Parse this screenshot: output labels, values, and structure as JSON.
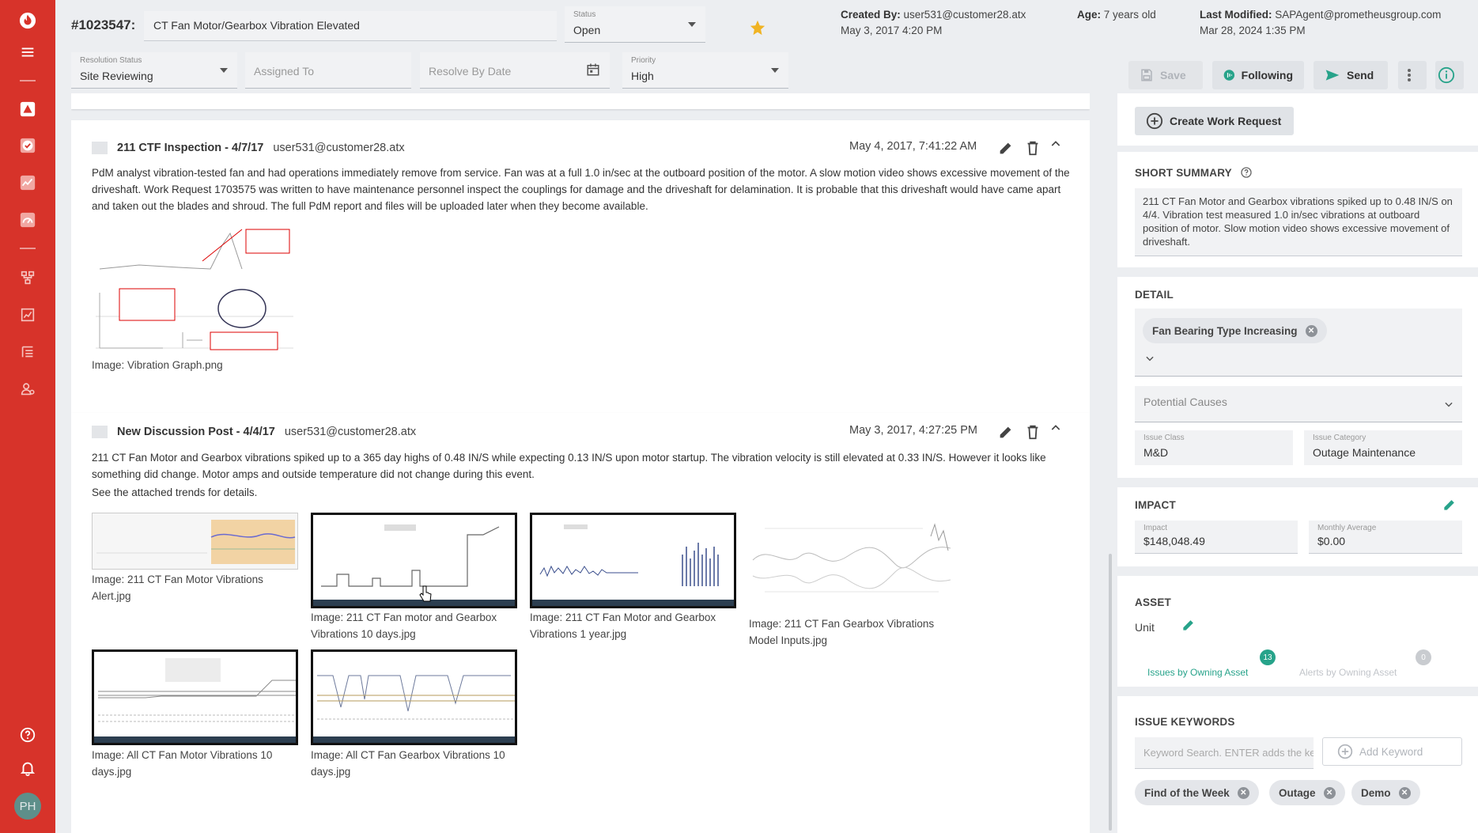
{
  "header": {
    "issue_id": "#1023547:",
    "title": "CT Fan Motor/Gearbox Vibration Elevated",
    "status_label": "Status",
    "status_value": "Open",
    "resolution_label": "Resolution Status",
    "resolution_value": "Site Reviewing",
    "assigned_placeholder": "Assigned To",
    "resolve_placeholder": "Resolve By Date",
    "priority_label": "Priority",
    "priority_value": "High",
    "created_label": "Created By:",
    "created_by": "user531@customer28.atx",
    "created_date": "May 3, 2017 4:20 PM",
    "age_label": "Age:",
    "age_value": "7 years old",
    "modified_label": "Last Modified:",
    "modified_by": "SAPAgent@prometheusgroup.com",
    "modified_date": "Mar 28, 2024 1:35 PM",
    "save_label": "Save",
    "following_label": "Following",
    "send_label": "Send"
  },
  "posts": [
    {
      "title": "211 CTF Inspection - 4/7/17",
      "author": "user531@customer28.atx",
      "date": "May 4, 2017, 7:41:22 AM",
      "body": "PdM analyst vibration-tested fan and had operations immediately remove from service. Fan was at a full 1.0 in/sec at the outboard position of the motor. A slow motion video shows excessive movement of the driveshaft. Work Request 1703575 was written to have maintenance personnel inspect the couplings for damage and the driveshaft for delamination. It is probable that this driveshaft would have came apart and taken out the blades and shroud. The full PdM report and files will be uploaded later when they become available.",
      "images": [
        {
          "caption": "Image: Vibration Graph.png"
        }
      ]
    },
    {
      "title": "New Discussion Post - 4/4/17",
      "author": "user531@customer28.atx",
      "date": "May 3, 2017, 4:27:25 PM",
      "body": "211 CT Fan Motor and Gearbox vibrations spiked up to a 365 day highs of 0.48 IN/S while expecting 0.13 IN/S upon motor startup.  The vibration velocity is still elevated at 0.33 IN/S. However it looks like something did change.  Motor amps and outside temperature did not change during this event.",
      "body2": "See the attached trends for details.",
      "images": [
        {
          "caption": "Image: 211 CT Fan Motor Vibrations Alert.jpg"
        },
        {
          "caption": "Image: 211 CT Fan motor and Gearbox Vibrations 10 days.jpg"
        },
        {
          "caption": "Image: 211 CT Fan Motor and Gearbox Vibrations 1 year.jpg"
        },
        {
          "caption": "Image: 211 CT Fan Gearbox Vibrations Model Inputs.jpg"
        },
        {
          "caption": "Image: All CT Fan Motor Vibrations 10 days.jpg"
        },
        {
          "caption": "Image: All CT Fan Gearbox Vibrations 10 days.jpg"
        }
      ]
    }
  ],
  "panel": {
    "create_work_request": "Create Work Request",
    "short_summary_title": "SHORT SUMMARY",
    "short_summary": "211 CT Fan Motor and Gearbox vibrations spiked up to 0.48 IN/S on 4/4. Vibration test measured 1.0 in/sec vibrations at outboard position of motor. Slow motion video shows excessive movement of driveshaft.",
    "detail_title": "DETAIL",
    "detail_chip": "Fan Bearing Type Increasing",
    "potential_causes": "Potential Causes",
    "issue_class_label": "Issue Class",
    "issue_class_value": "M&D",
    "issue_category_label": "Issue Category",
    "issue_category_value": "Outage Maintenance",
    "impact_title": "IMPACT",
    "impact_label": "Impact",
    "impact_value": "$148,048.49",
    "monthly_label": "Monthly Average",
    "monthly_value": "$0.00",
    "asset_title": "ASSET",
    "asset_unit": "Unit",
    "issues_by_asset_count": "13",
    "issues_by_asset_label": "Issues by Owning Asset",
    "alerts_by_asset_count": "0",
    "alerts_by_asset_label": "Alerts by Owning Asset",
    "keywords_title": "ISSUE KEYWORDS",
    "keyword_placeholder": "Keyword Search. ENTER adds the keyword",
    "add_keyword": "Add Keyword",
    "keywords": [
      "Find of the Week",
      "Outage",
      "Demo"
    ]
  },
  "colors": {
    "sidebar": "#d7332a",
    "accent_green": "#27a38a",
    "star": "#f0b323"
  }
}
